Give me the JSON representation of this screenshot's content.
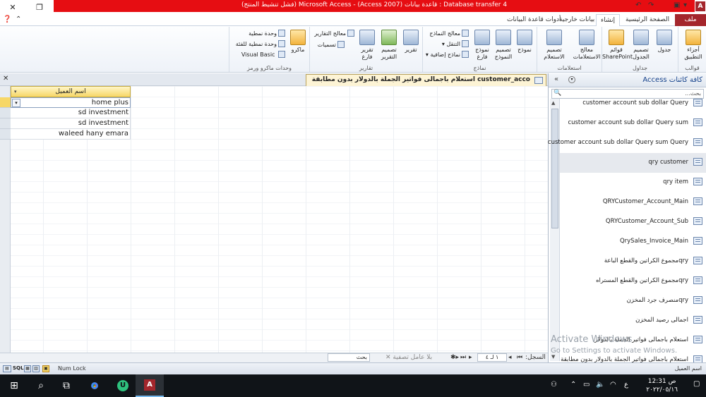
{
  "window": {
    "title": "Database transfer 4 : قاعدة بيانات (Access 2007) - Microsoft Access (فشل تنشيط المنتج)",
    "logo_letter": "A"
  },
  "ribbon_tabs": [
    {
      "label": "ملف"
    },
    {
      "label": "الصفحة الرئيسية"
    },
    {
      "label": "إنشاء"
    },
    {
      "label": "بيانات خارجية"
    },
    {
      "label": "أدوات قاعدة البيانات"
    }
  ],
  "ribbon": {
    "groups": {
      "templates": "قوالب",
      "tables": "جداول",
      "queries": "استعلامات",
      "forms": "نماذج",
      "reports": "تقارير",
      "macros": "وحدات ماكرو ورمز"
    },
    "buttons": {
      "app_parts": "أجزاء التطبيق",
      "table": "جدول",
      "table_design": "تصميم الجدول",
      "sharepoint_lists": "قوائم SharePoint",
      "query_wizard": "معالج الاستعلامات",
      "query_design": "تصميم الاستعلام",
      "form": "نموذج",
      "form_design": "تصميم النموذج",
      "blank_form": "نموذج فارغ",
      "form_wizard": "معالج النماذج",
      "navigation": "التنقل",
      "more_forms": "نماذج إضافية",
      "report": "تقرير",
      "report_design": "تصميم التقرير",
      "blank_report": "تقرير فارغ",
      "report_wizard": "معالج التقارير",
      "labels": "تسميات",
      "macro": "ماكرو",
      "module": "وحدة نمطية",
      "class_module": "وحدة نمطية للفئة",
      "visual_basic": "Visual Basic"
    }
  },
  "document_tab": {
    "title": "customer_acco استعلام باجمالى فواتير الجملة بالدولار بدون مطابقة"
  },
  "datasheet": {
    "column_header": "اسم العميل",
    "rows": [
      {
        "value": "home plus"
      },
      {
        "value": "sd investment"
      },
      {
        "value": "sd investment"
      },
      {
        "value": "waleed hany emara"
      }
    ]
  },
  "record_nav": {
    "label": "السجل:",
    "current": "١ لـ ٤",
    "filter": "بلا عامل تصفية",
    "search": "بحث"
  },
  "nav_pane": {
    "title": "كافة كائنات Access",
    "search_placeholder": "بحث...",
    "items": [
      {
        "label": "customer account sub dollar Query"
      },
      {
        "label": "customer account sub dollar Query sum"
      },
      {
        "label": "customer account sub dollar Query sum Query"
      },
      {
        "label": "qry customer"
      },
      {
        "label": "qry item"
      },
      {
        "label": "QRYCustomer_Account_Main"
      },
      {
        "label": "QRYCustomer_Account_Sub"
      },
      {
        "label": "QrySales_Invoice_Main"
      },
      {
        "label": "qryمجموع الكراتين والقطع الباعة"
      },
      {
        "label": "qryمجموع الكراتين والقطع المستراه"
      },
      {
        "label": "qryمنصرف جرد المخزن"
      },
      {
        "label": "اجمالى رصيد المخزن"
      },
      {
        "label": "استعلام باجمالى فواتير الجملة بالدولار"
      },
      {
        "label": "استعلام باجمالى فواتير الجملة بالدولار بدون مطابقة"
      }
    ]
  },
  "watermark": {
    "line1": "Activate Windows",
    "line2": "Go to Settings to activate Windows."
  },
  "status": {
    "left": "Num Lock",
    "right": "اسم العميل",
    "sql": "SQL"
  },
  "taskbar": {
    "time": "12:31 ص",
    "date": "٢٠٢٢/٠٥/١٦",
    "lang": "ع"
  }
}
